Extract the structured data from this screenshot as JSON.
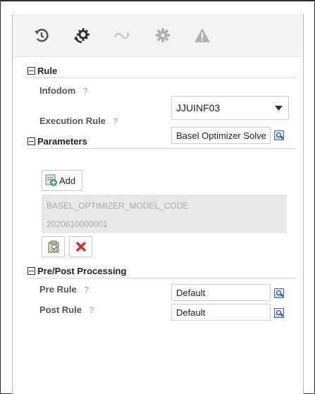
{
  "toolbar": {
    "icons": [
      "history-icon",
      "settings-run-icon",
      "wave-icon",
      "gear-icon",
      "warning-icon"
    ]
  },
  "rule_section": {
    "title": "Rule",
    "infodom": {
      "label": "Infodom",
      "help": "?",
      "value": "JJUINF03"
    },
    "execution_rule": {
      "label": "Execution Rule",
      "help": "?",
      "value": "Basel Optimizer Solve"
    }
  },
  "parameters_section": {
    "title": "Parameters",
    "add_label": "Add",
    "param_name": "BASEL_OPTIMIZER_MODEL_CODE",
    "param_value": "2020810000001"
  },
  "prepost_section": {
    "title": "Pre/Post Processing",
    "pre_rule": {
      "label": "Pre Rule",
      "help": "?",
      "value": "Default"
    },
    "post_rule": {
      "label": "Post Rule",
      "help": "?",
      "value": "Default"
    }
  },
  "colors": {
    "toolbar_bg": "#f3f3f3",
    "help_icon": "#e0a59a",
    "delete_icon": "#d32f2f",
    "param_bg": "#e8e8e8"
  }
}
